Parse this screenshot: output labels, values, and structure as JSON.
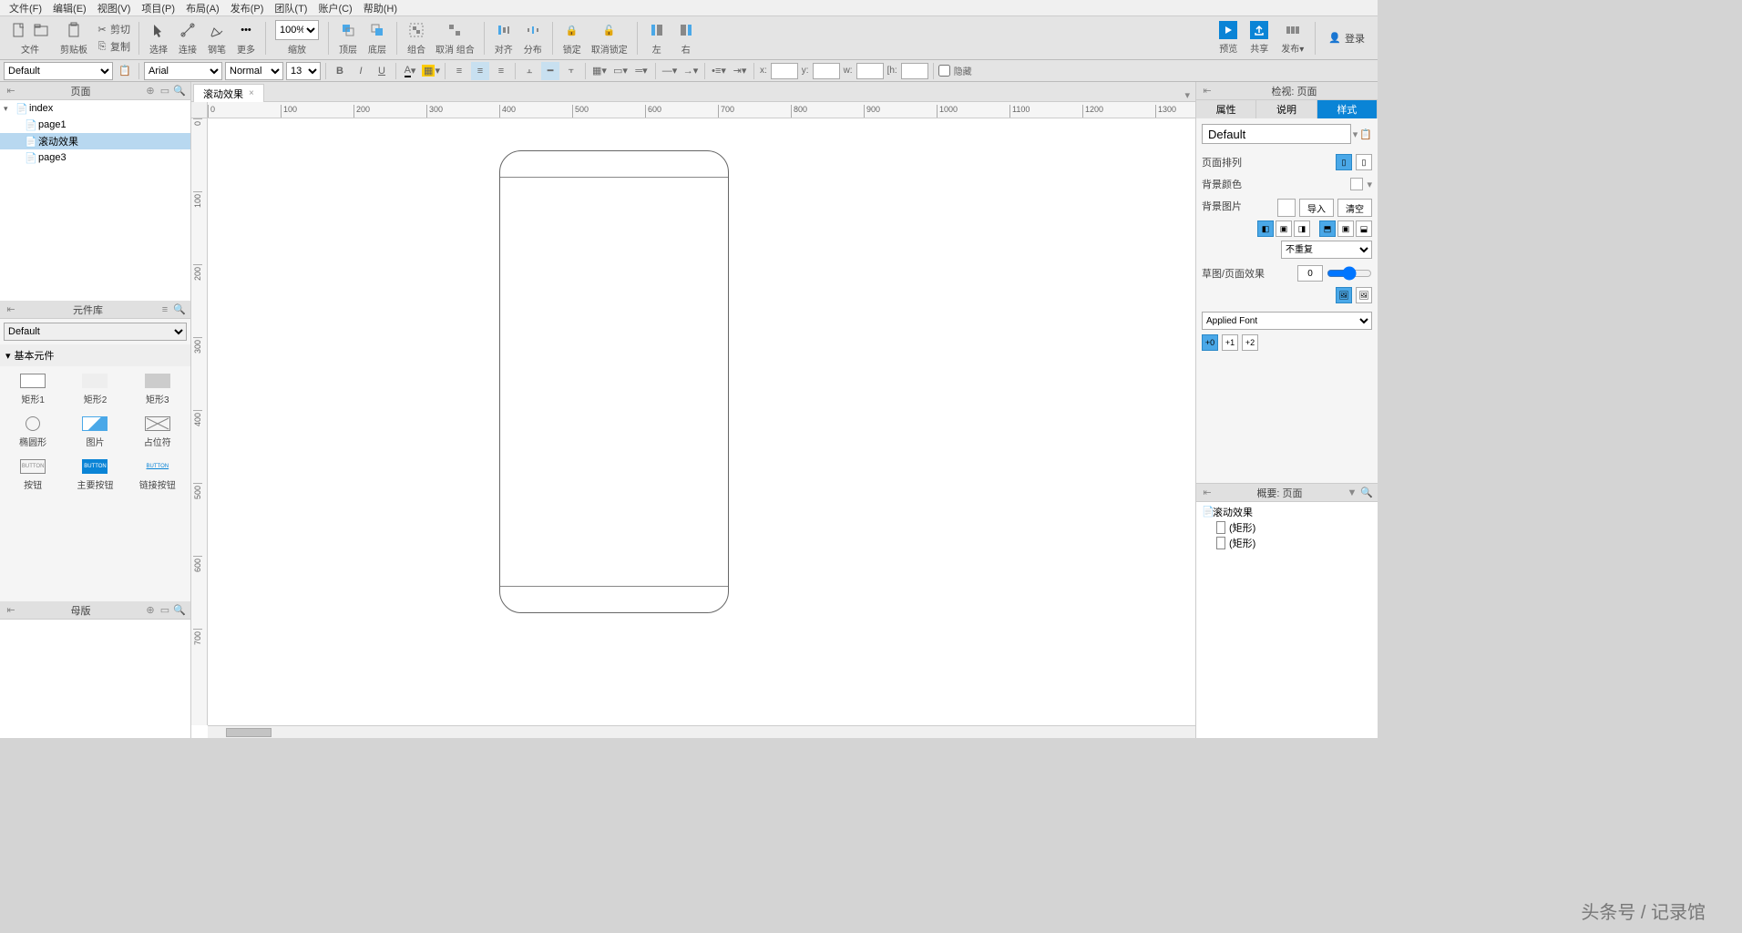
{
  "menu": {
    "items": [
      "文件(F)",
      "编辑(E)",
      "视图(V)",
      "项目(P)",
      "布局(A)",
      "发布(P)",
      "团队(T)",
      "账户(C)",
      "帮助(H)"
    ]
  },
  "toolbar": {
    "cut": "剪切",
    "copy": "复制",
    "paste": "粘贴",
    "file": "文件",
    "clipboard": "剪贴板",
    "select": "选择",
    "connect": "连接",
    "pen": "钢笔",
    "more": "更多",
    "zoom": "100%",
    "zoom_lbl": "缩放",
    "top": "顶层",
    "bottom": "底层",
    "group": "组合",
    "ungroup": "取消 组合",
    "align": "对齐",
    "distribute": "分布",
    "lock": "锁定",
    "unlock": "取消锁定",
    "left": "左",
    "right": "右",
    "preview": "预览",
    "share": "共享",
    "publish": "发布▾",
    "login": "登录"
  },
  "formatbar": {
    "style_sel": "Default",
    "font": "Arial",
    "weight": "Normal",
    "size": "13",
    "x": "x:",
    "y": "y:",
    "w": "w:",
    "h": "[h:",
    "hidden": "隐藏"
  },
  "panels": {
    "pages_title": "页面",
    "tree_root": "index",
    "tree_children": [
      "page1",
      "滚动效果",
      "page3"
    ],
    "tree_selected": 1,
    "lib_title": "元件库",
    "lib_sel": "Default",
    "lib_cat": "基本元件",
    "lib_items": [
      "矩形1",
      "矩形2",
      "矩形3",
      "椭圆形",
      "图片",
      "占位符",
      "按钮",
      "主要按钮",
      "链接按钮"
    ],
    "masters_title": "母版"
  },
  "canvas": {
    "tab_name": "滚动效果",
    "ruler_h": [
      0,
      100,
      200,
      300,
      400,
      500,
      600,
      700,
      800,
      900,
      1000,
      1100,
      1200,
      1300
    ],
    "ruler_v": [
      0,
      100,
      200,
      300,
      400,
      500,
      600,
      700
    ]
  },
  "inspector": {
    "header": "检视: 页面",
    "tabs": [
      "属性",
      "说明",
      "样式"
    ],
    "active_tab": 2,
    "style_name": "Default",
    "page_arrange": "页面排列",
    "bg_color": "背景颜色",
    "bg_image": "背景图片",
    "import": "导入",
    "clear": "清空",
    "repeat": "不重复",
    "sketch": "草图/页面效果",
    "sketch_val": "0",
    "applied_font": "Applied Font",
    "sizes": [
      "+0",
      "+1",
      "+2"
    ]
  },
  "outline": {
    "header": "概要: 页面",
    "root": "滚动效果",
    "items": [
      "(矩形)",
      "(矩形)"
    ]
  },
  "watermark": "头条号 / 记录馆"
}
